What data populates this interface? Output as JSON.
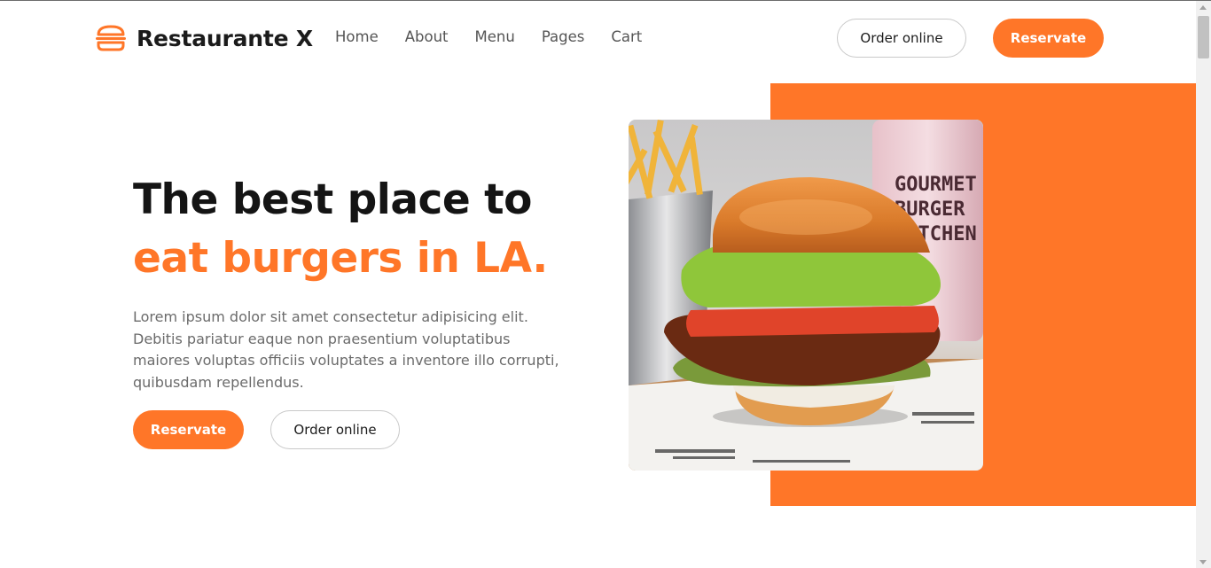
{
  "brand": {
    "name": "Restaurante X",
    "logo_icon": "burger-icon",
    "accent": "#ff7628"
  },
  "nav": {
    "items": [
      "Home",
      "About",
      "Menu",
      "Pages",
      "Cart"
    ]
  },
  "header": {
    "order_label": "Order online",
    "reserve_label": "Reservate"
  },
  "hero": {
    "headline_line1": "The best place to",
    "headline_line2": "eat burgers in LA.",
    "description": "Lorem ipsum dolor sit amet consectetur adipisicing elit. Debitis pariatur eaque non praesentium voluptatibus maiores voluptas officiis voluptates a inventore illo corrupti, quibusdam repellendus.",
    "reserve_label": "Reservate",
    "order_label": "Order online",
    "image_cup_text": [
      "GOURMET",
      "BURGER",
      "KITCHEN"
    ]
  },
  "colors": {
    "accent": "#ff7628",
    "text_dark": "#141414",
    "text_muted": "#6b6b6b"
  }
}
